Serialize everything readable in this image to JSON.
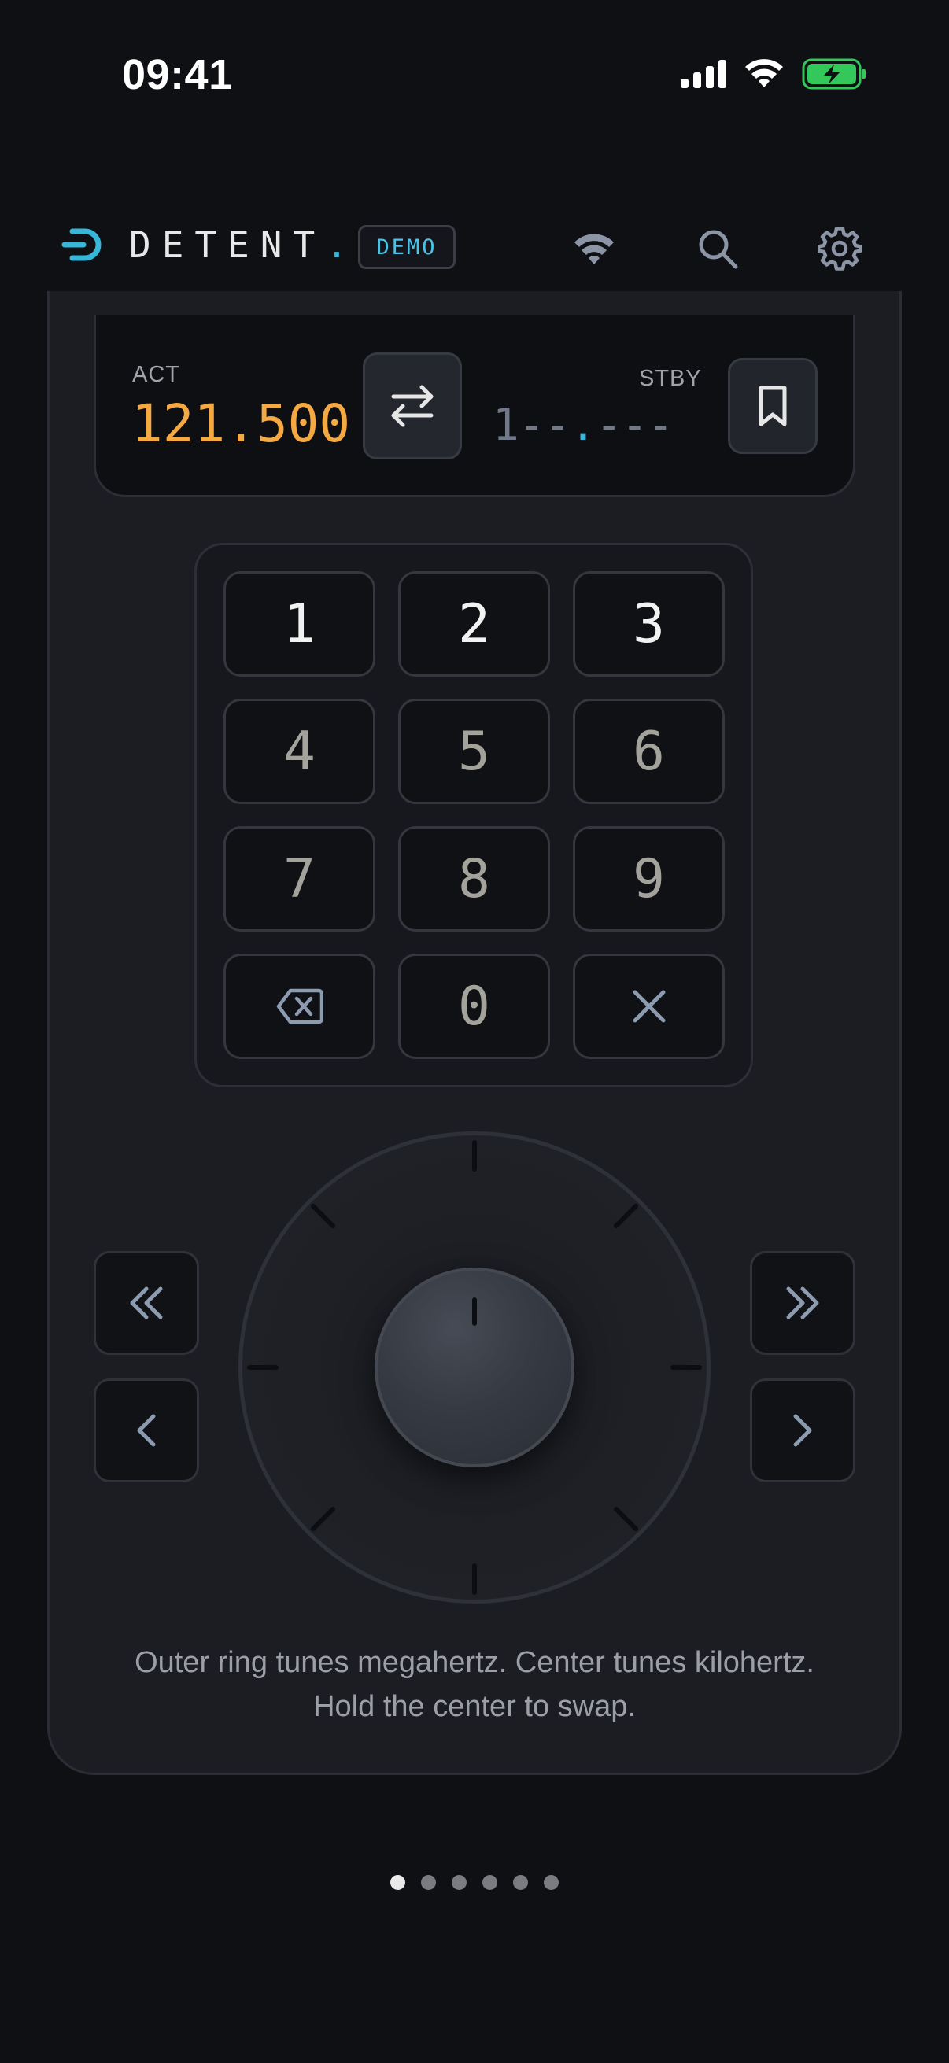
{
  "status_bar": {
    "time": "09:41",
    "icons": [
      "signal-icon",
      "wifi-icon",
      "battery-charging-icon"
    ]
  },
  "header": {
    "brand": "DETENT",
    "brand_dot": ".",
    "badge": "DEMO",
    "icons": [
      "connection-icon",
      "search-icon",
      "gear-icon"
    ]
  },
  "frequency": {
    "active_label": "ACT",
    "active_value": "121.500",
    "standby_label": "STBY",
    "standby_entered": "1",
    "standby_pending_mhz": "--",
    "standby_decimal": ".",
    "standby_pending_khz": "---"
  },
  "keypad": {
    "keys": [
      "1",
      "2",
      "3",
      "4",
      "5",
      "6",
      "7",
      "8",
      "9",
      "0"
    ]
  },
  "tuner": {
    "buttons": [
      "double-chevron-left-icon",
      "chevron-left-icon",
      "double-chevron-right-icon",
      "chevron-right-icon"
    ]
  },
  "caption": {
    "line1": "Outer ring tunes megahertz. Center tunes kilohertz.",
    "line2": "Hold the center to swap."
  },
  "pager": {
    "total_pages": 6,
    "active_page": 1
  },
  "colors": {
    "background": "#0f1014",
    "panel": "#1b1d23",
    "active_frequency": "#f4a942",
    "accent": "#38b6d8",
    "battery": "#34c759"
  }
}
